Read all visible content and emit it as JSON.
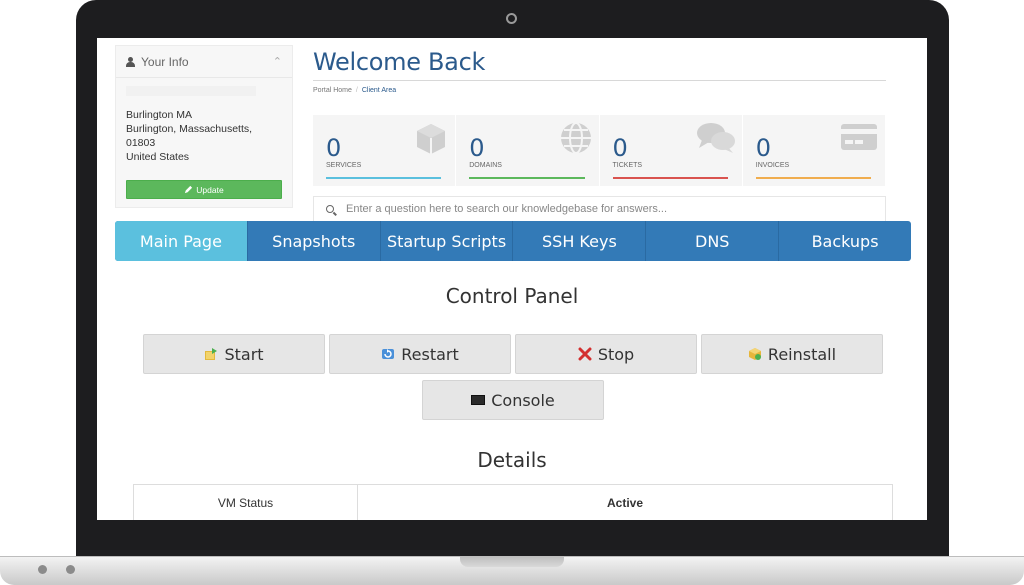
{
  "info": {
    "header": "Your Info",
    "address": [
      "Burlington MA",
      "Burlington, Massachusetts,",
      "01803",
      "United States"
    ],
    "update_label": "Update"
  },
  "welcome": {
    "title": "Welcome Back",
    "breadcrumb": [
      "Portal Home",
      "Client Area"
    ]
  },
  "tiles": [
    {
      "value": "0",
      "label": "SERVICES",
      "color": "#5bc0de",
      "icon": "cube-icon"
    },
    {
      "value": "0",
      "label": "DOMAINS",
      "color": "#5cb85c",
      "icon": "globe-icon"
    },
    {
      "value": "0",
      "label": "TICKETS",
      "color": "#d9534f",
      "icon": "comments-icon"
    },
    {
      "value": "0",
      "label": "INVOICES",
      "color": "#f0ad4e",
      "icon": "credit-card-icon"
    }
  ],
  "search": {
    "placeholder": "Enter a question here to search our knowledgebase for answers..."
  },
  "tabs": [
    "Main Page",
    "Snapshots",
    "Startup Scripts",
    "SSH Keys",
    "DNS",
    "Backups"
  ],
  "control_panel": {
    "title": "Control Panel",
    "buttons": {
      "start": "Start",
      "restart": "Restart",
      "stop": "Stop",
      "reinstall": "Reinstall",
      "console": "Console"
    }
  },
  "details": {
    "title": "Details",
    "rows": [
      {
        "label": "VM Status",
        "value": "Active"
      }
    ]
  }
}
